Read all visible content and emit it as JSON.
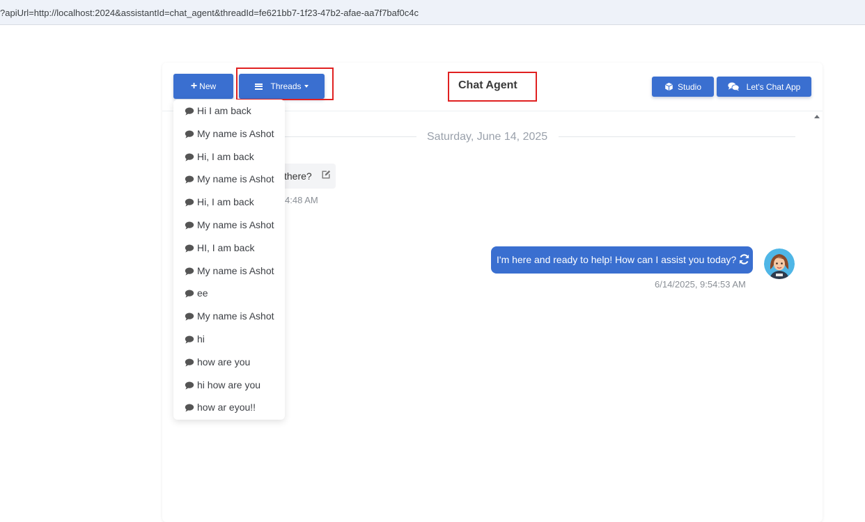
{
  "browser": {
    "url": "?apiUrl=http://localhost:2024&assistantId=chat_agent&threadId=fe621bb7-1f23-47b2-afae-aa7f7baf0c4c"
  },
  "header": {
    "new_label": "New",
    "threads_label": "Threads",
    "title": "Chat Agent",
    "studio_label": "Studio",
    "chat_app_label": "Let's Chat App"
  },
  "chat": {
    "date_separator": "Saturday, June 14, 2025",
    "user_message_visible": "there?",
    "user_time_visible": "4:48 AM",
    "assistant_message": "I'm here and ready to help! How can I assist you today?",
    "assistant_time": "6/14/2025, 9:54:53 AM"
  },
  "threads": [
    "Hi I am back",
    "My name is Ashot",
    "Hi, I am back",
    "My name is Ashot",
    "Hi, I am back",
    "My name is Ashot",
    "HI, I am back",
    "My name is Ashot",
    "ee",
    "My name is Ashot",
    "hi",
    "how are you",
    "hi how are you",
    "how ar eyou!!"
  ],
  "colors": {
    "primary": "#3a6fd0",
    "highlight": "#e02020"
  },
  "icons": {
    "thread_item": "comment-icon",
    "studio": "cube-icon",
    "chat_app": "comments-icon",
    "edit": "edit-icon",
    "refresh": "refresh-icon"
  }
}
